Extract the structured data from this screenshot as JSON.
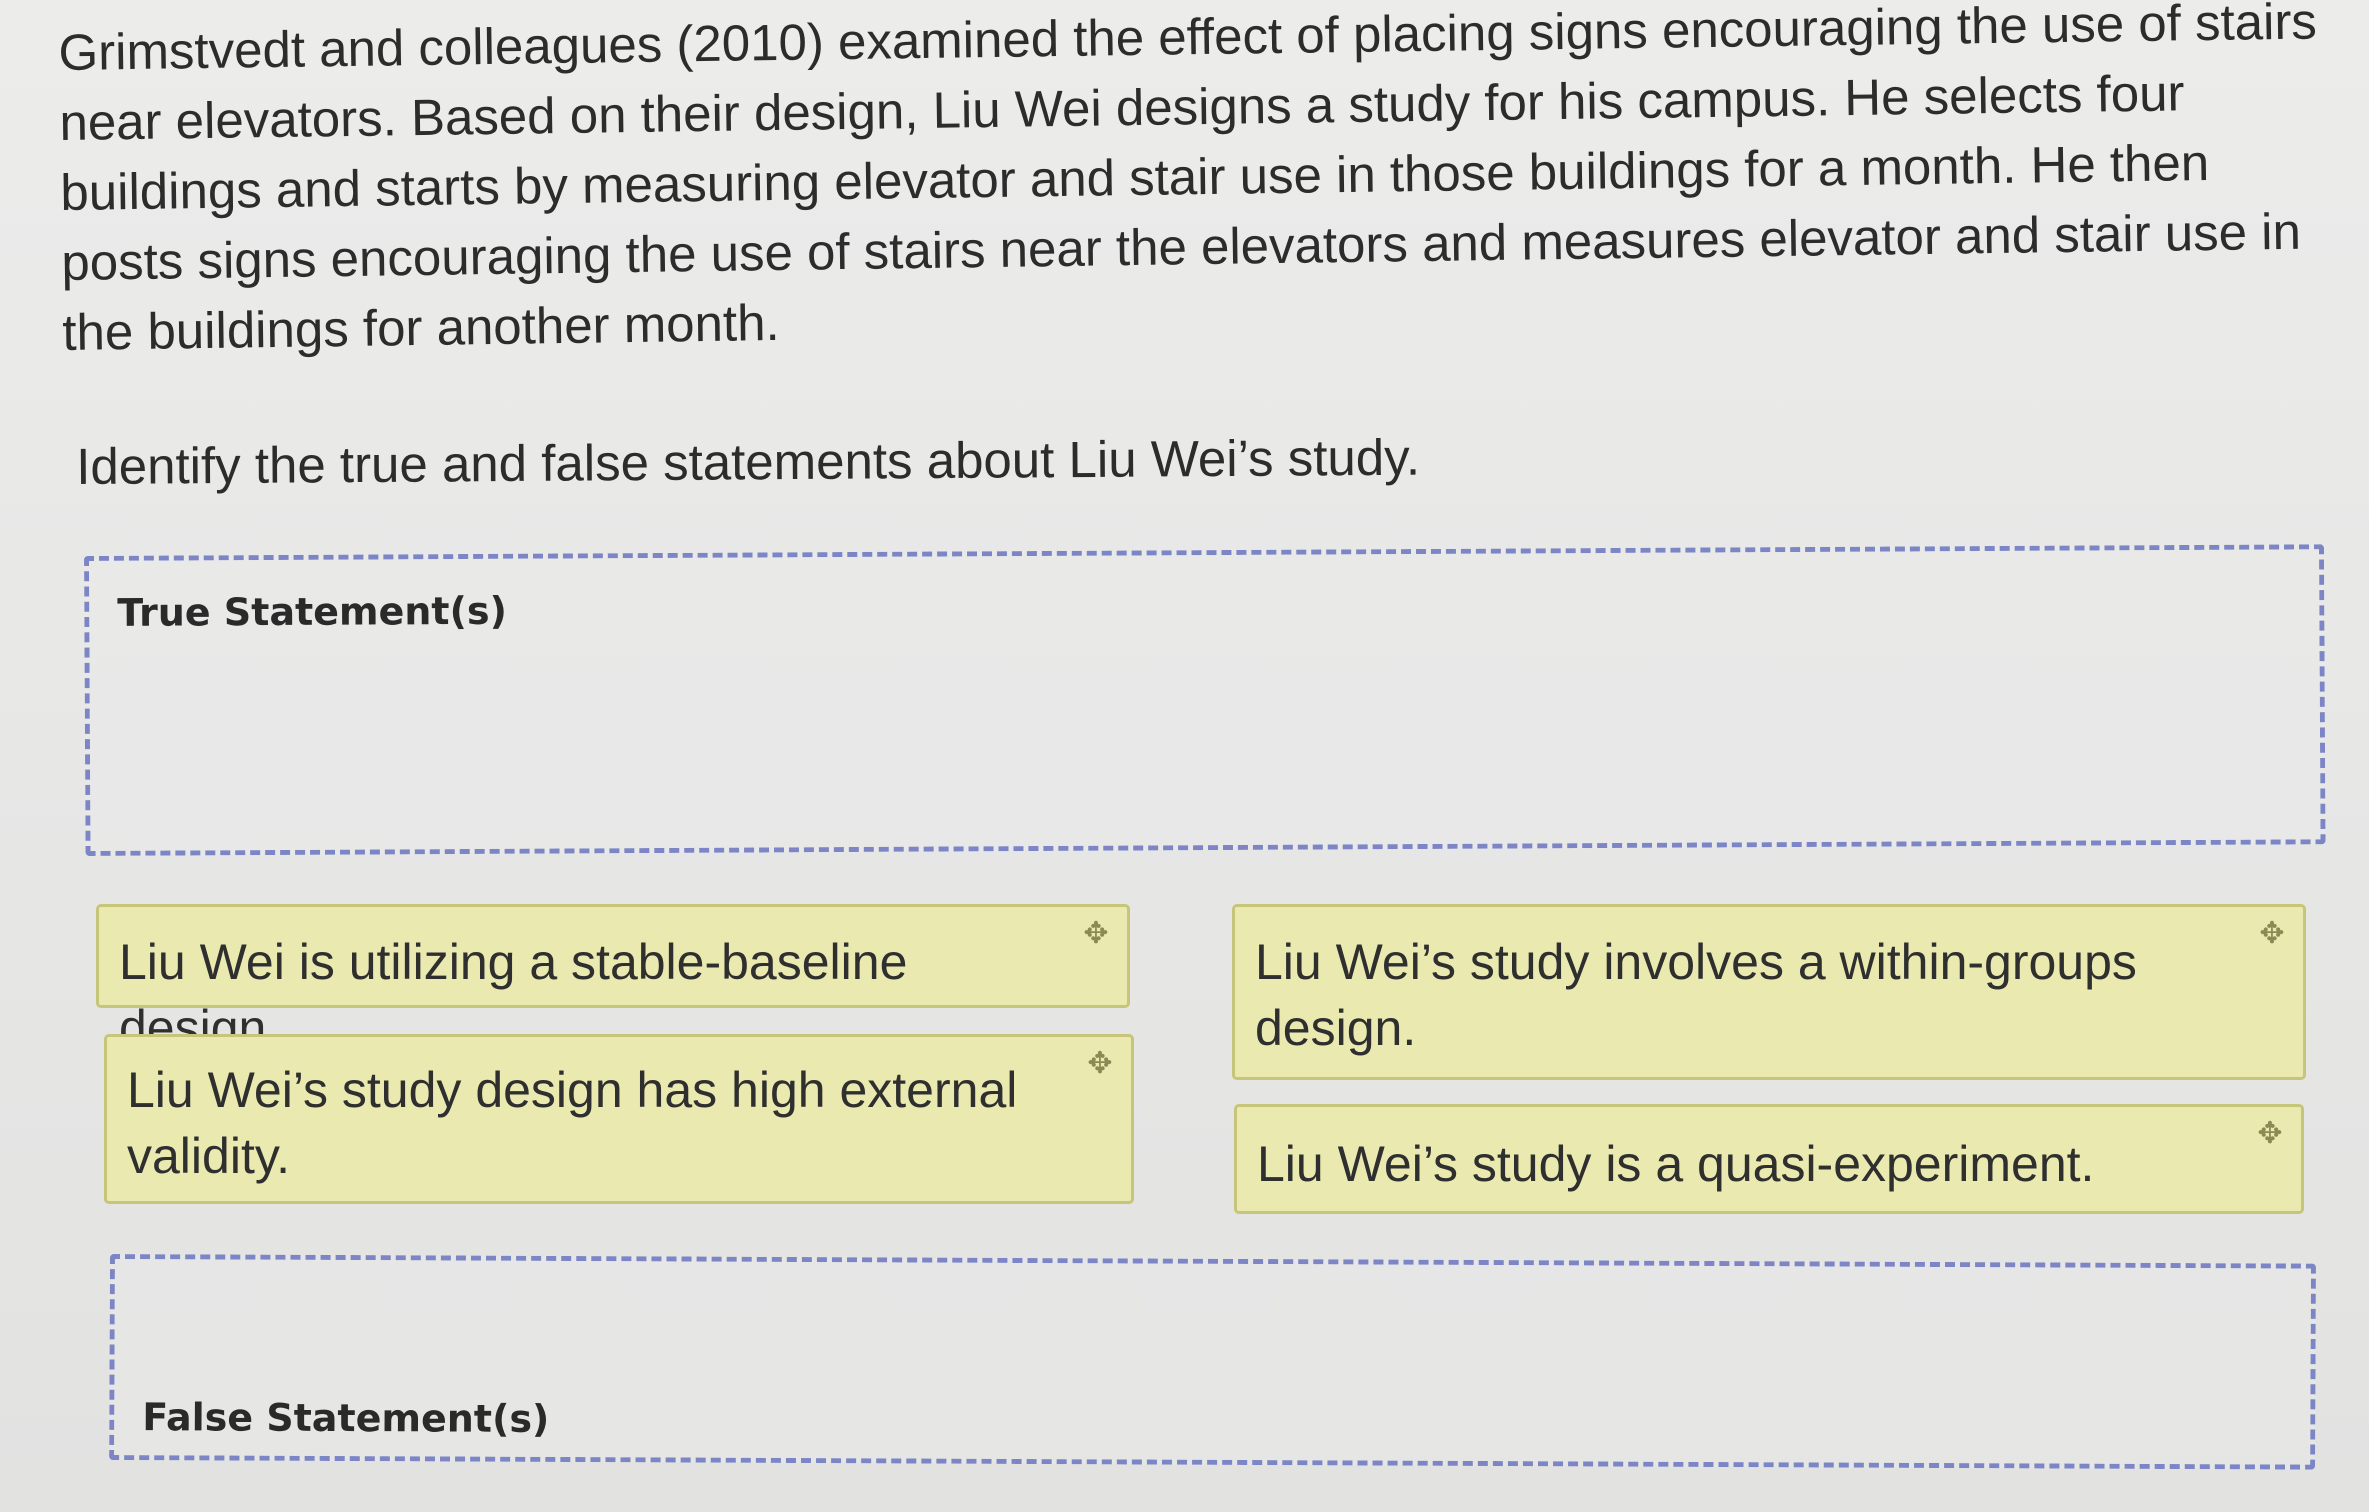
{
  "question": {
    "paragraph": "Grimstvedt and colleagues (2010) examined the effect of placing signs encouraging the use of stairs near elevators. Based on their design, Liu Wei designs a study for his campus. He selects four buildings and starts by measuring elevator and stair use in those buildings for a month. He then posts signs encouraging the use of stairs near the elevators and measures elevator and stair use in the buildings for another month.",
    "prompt": "Identify the true and false statements about Liu Wei’s study."
  },
  "zones": {
    "true_label": "True Statement(s)",
    "false_label": "False Statement(s)"
  },
  "cards": [
    {
      "text": "Liu Wei is utilizing a stable-baseline design.",
      "icon": "move-icon"
    },
    {
      "text": "Liu Wei’s study design has high external validity.",
      "icon": "move-icon"
    },
    {
      "text": "Liu Wei’s study involves a within-groups design.",
      "icon": "move-icon"
    },
    {
      "text": "Liu Wei’s study is a quasi-experiment.",
      "icon": "move-icon"
    }
  ],
  "colors": {
    "card_background": "#eaeab0",
    "card_border": "#c6c57a",
    "dropzone_border": "#7c86c6"
  }
}
